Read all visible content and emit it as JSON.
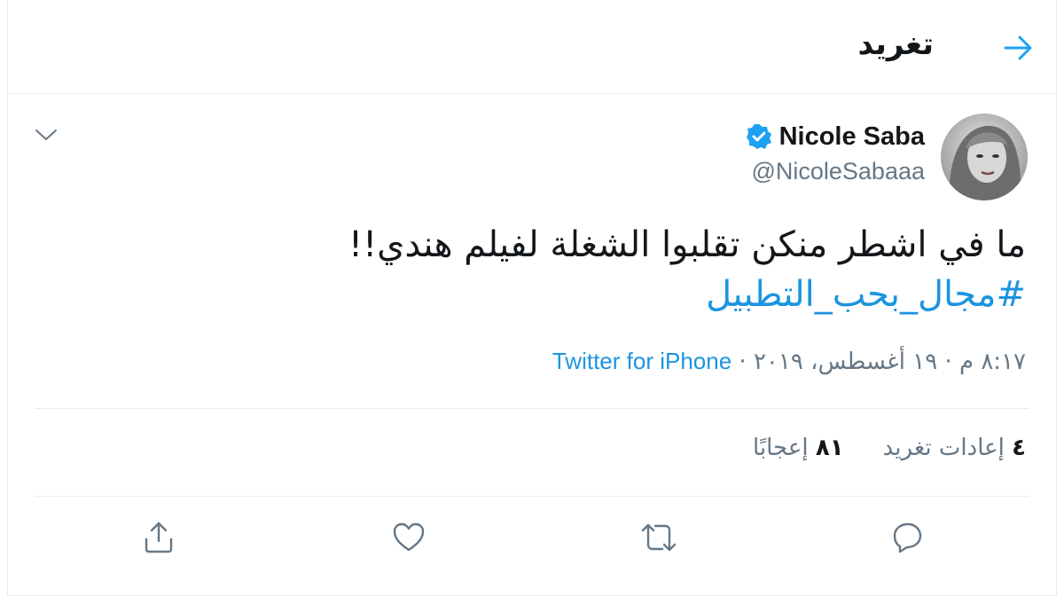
{
  "header": {
    "title": "تغريد"
  },
  "tweet": {
    "author_name": "Nicole Saba",
    "author_handle": "@NicoleSabaaa",
    "text": "ما في اشطر منكن تقلبوا الشغلة لفيلم هندي!!",
    "hashtag": "#مجال_بحب_التطبيل",
    "timestamp": "٨:١٧ م · ١٩ أغسطس، ٢٠١٩",
    "separator": " · ",
    "source": "Twitter for iPhone"
  },
  "stats": {
    "retweets_count": "٤",
    "retweets_label": "إعادات تغريد",
    "likes_count": "٨١",
    "likes_label": "إعجابًا"
  },
  "colors": {
    "accent": "#1da1f2",
    "link": "#1b95e0",
    "muted": "#657786",
    "border": "#e6ecf0"
  },
  "icons": [
    "back-arrow-icon",
    "verified-badge-icon",
    "chevron-down-icon",
    "reply-icon",
    "retweet-icon",
    "like-icon",
    "share-icon"
  ]
}
